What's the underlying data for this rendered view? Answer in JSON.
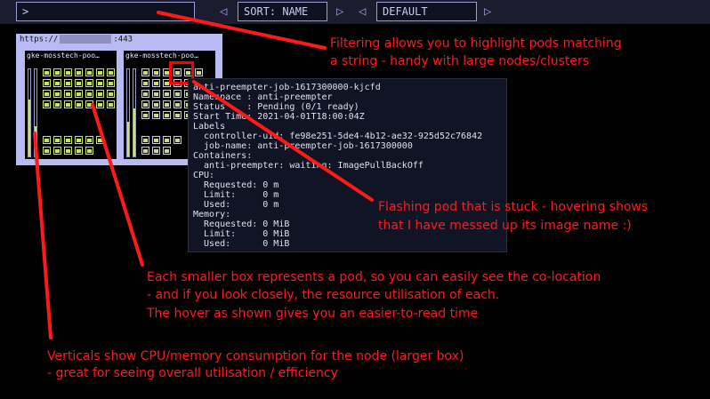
{
  "toolbar": {
    "filter_value": ">",
    "sort_label": "SORT: NAME",
    "group_label": "DEFAULT",
    "left_arrow": "◁",
    "right_arrow": "▷"
  },
  "cluster": {
    "url_prefix": "https://",
    "url_suffix": ":443",
    "nodes": [
      {
        "name": "gke-mosstech-poo…",
        "cpu_fraction": 0.65,
        "memory_fraction": 0.35
      },
      {
        "name": "gke-mosstech-poo…",
        "cpu_fraction": 0.4,
        "memory_fraction": 0.55
      }
    ]
  },
  "tooltip": {
    "lines": [
      "anti-preempter-job-1617300000-kjcfd",
      "Namespace : anti-preempter",
      "Status    : Pending (0/1 ready)",
      "Start Time: 2021-04-01T18:00:04Z",
      "Labels",
      "  controller-uid: fe98e251-5de4-4b12-ae32-925d52c76842",
      "  job-name: anti-preempter-job-1617300000",
      "Containers:",
      "  anti-preempter: waiting: ImagePullBackOff",
      "CPU:",
      "  Requested: 0 m",
      "  Limit:     0 m",
      "  Used:      0 m",
      "Memory:",
      "  Requested: 0 MiB",
      "  Limit:     0 MiB",
      "  Used:      0 MiB"
    ]
  },
  "annotations": {
    "filter_1": "Filtering allows you to highlight pods matching",
    "filter_2": "a string - handy with large nodes/clusters",
    "stuck_1": "Flashing pod that is stuck - hovering shows",
    "stuck_2": "that I have messed up its image name :)",
    "pod_1": "Each smaller box represents a pod, so you can easily see the co-location",
    "pod_2": "- and if you look closely, the resource utilisation of each.",
    "pod_3": "The hover as shown gives you an easier-to-read time",
    "vert_1": "Verticals show CPU/memory consumption for the node (larger box)",
    "vert_2": "- great for seeing overall utilisation / efficiency"
  },
  "colors": {
    "annotation": "#ff1a1a",
    "pod": "#c7e36a",
    "accent": "#9a9cd6"
  }
}
